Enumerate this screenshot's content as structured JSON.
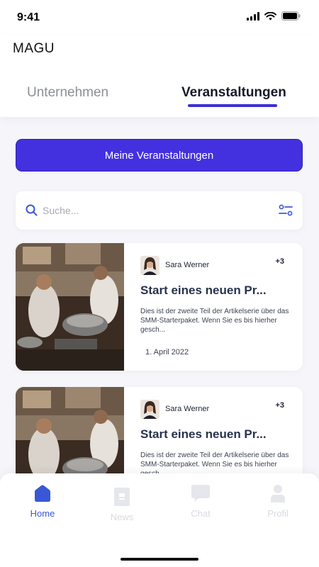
{
  "status": {
    "time": "9:41"
  },
  "app": {
    "title": "MAGU"
  },
  "tabs": [
    {
      "label": "Unternehmen",
      "active": false
    },
    {
      "label": "Veranstaltungen",
      "active": true
    }
  ],
  "primary_action": {
    "label": "Meine Veranstaltungen"
  },
  "search": {
    "placeholder": "Suche..."
  },
  "events": [
    {
      "author": "Sara Werner",
      "extra_count": "+3",
      "title": "Start eines neuen Pr...",
      "description": "Dies ist der zweite Teil der Artikelserie über das SMM-Starterpaket. Wenn Sie es bis hierher gesch...",
      "date": "1. April 2022"
    },
    {
      "author": "Sara Werner",
      "extra_count": "+3",
      "title": "Start eines neuen Pr...",
      "description": "Dies ist der zweite Teil der Artikelserie über das SMM-Starterpaket. Wenn Sie es bis hierher gesch..."
    }
  ],
  "nav": [
    {
      "label": "Home",
      "icon": "home-icon",
      "active": true
    },
    {
      "label": "News",
      "icon": "news-icon",
      "active": false
    },
    {
      "label": "Chat",
      "icon": "chat-icon",
      "active": false
    },
    {
      "label": "Profil",
      "icon": "profile-icon",
      "active": false
    }
  ],
  "colors": {
    "accent": "#4331e0",
    "nav_active": "#3a57d6",
    "tab_underline": "#3b2fd8"
  }
}
